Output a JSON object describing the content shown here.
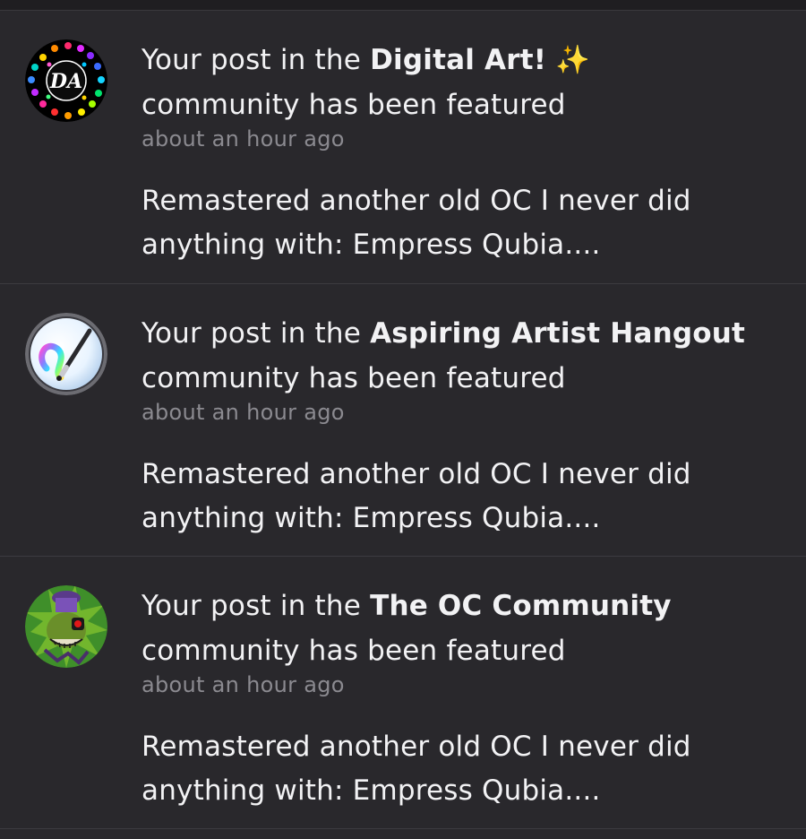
{
  "notifications": [
    {
      "prefix": "Your post in the",
      "community": "Digital Art!",
      "suffix": "community has been featured",
      "sparkle": "✨",
      "time": "about an hour ago",
      "excerpt": "Remastered another old OC I never did anything with: Empress Qubia....",
      "avatar_icon": "digital-art-logo-icon"
    },
    {
      "prefix": "Your post in the",
      "community": "Aspiring Artist Hangout",
      "suffix": "community has been featured",
      "time": "about an hour ago",
      "excerpt": "Remastered another old OC I never did anything with: Empress Qubia....",
      "avatar_icon": "paintbrush-logo-icon"
    },
    {
      "prefix": "Your post in the",
      "community": "The OC Community",
      "suffix": "community has been featured",
      "time": "about an hour ago",
      "excerpt": "Remastered another old OC I never did anything with: Empress Qubia....",
      "avatar_icon": "oc-character-logo-icon"
    }
  ],
  "colors": {
    "background": "#29282c",
    "text": "#f2f2f4",
    "muted": "#8b8a90",
    "divider": "#3c3b40"
  }
}
